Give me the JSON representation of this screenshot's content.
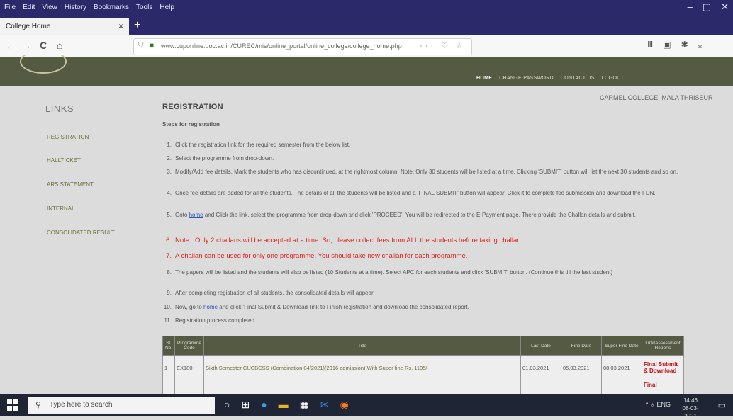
{
  "menu": [
    "File",
    "Edit",
    "View",
    "History",
    "Bookmarks",
    "Tools",
    "Help"
  ],
  "window_controls": [
    "–",
    "▢",
    "✕"
  ],
  "tab": {
    "title": "College Home",
    "close": "×"
  },
  "new_tab": "+",
  "nav": {
    "back": "←",
    "forward": "→",
    "reload": "C",
    "home": "⌂"
  },
  "url": "www.cuponline.uoc.ac.in/CUREC/mis/online_portal/online_college/college_home.php",
  "url_icons": "··· ♡ ☆",
  "toolbar_icons": [
    "Ⅲ",
    "▣",
    "✱",
    "⤓"
  ],
  "site_nav": [
    "HOME",
    "CHANGE PASSWORD",
    "CONTACT US",
    "LOGOUT"
  ],
  "college_name": "CARMEL COLLEGE, MALA THRISSUR",
  "links_title": "LINKS",
  "side_links": [
    "REGISTRATION",
    "HALLTICKET",
    "ARS STATEMENT",
    "INTERNAL",
    "CONSOLIDATED RESULT"
  ],
  "registration_title": "REGISTRATION",
  "steps_heading": "Steps for registration",
  "steps": [
    {
      "n": "1.",
      "text": "Click the registration link for the required semester from the below list."
    },
    {
      "n": "2.",
      "text": "Select the programme from drop-down."
    },
    {
      "n": "3.",
      "text": "Modify/Add fee details. Mark the students who has discontinued, at the rightmost column. Note: Only 30 students will be listed at a time. Clicking 'SUBMIT' button will list the next 30 students and so on."
    },
    {
      "n": "4.",
      "text": "Once fee details are added for all the students. The details of all the students will be listed and a 'FINAL SUBMIT' button will appear. Click it to complete fee submission and download the FDN."
    },
    {
      "n": "5.",
      "pre": "Goto ",
      "link": "home",
      "post": " and Click the link, select the programme from drop-down and click 'PROCEED'. You will be redirected to the E-Payment page. There provide the Challan details and submit."
    },
    {
      "n": "6.",
      "text": "Note : Only 2 challans will be accepted at a time. So, please collect fees from ALL the students before taking challan."
    },
    {
      "n": "7.",
      "text": "A challan can be used for only one programme. You should take new challan for each programme."
    },
    {
      "n": "8.",
      "text": "The papers will be listed and the students will also be listed (10 Students at a time). Select APC for each students and click 'SUBMIT' button. (Continue this till the last student)"
    },
    {
      "n": "9.",
      "text": "After completing registration of all students, the consolidated details will appear."
    },
    {
      "n": "10.",
      "pre": "Now, go to ",
      "link": "home",
      "post": " and click 'Final Submit & Download' link to Finish registration and download the consolidated report."
    },
    {
      "n": "11.",
      "text": "Registration process completed."
    }
  ],
  "table": {
    "headers": [
      "Sl. No.",
      "Programme Code",
      "Title",
      "Last Date",
      "Fine Date",
      "Super Fine Date",
      "Link/Assessment Reports"
    ],
    "rows": [
      {
        "sl": "1",
        "code": "EX180",
        "title": "Sixth Semester CUCBCSS (Combination 04/2021)(2016 admission) With Super fine Rs. 1105/-",
        "last": "01.03.2021",
        "fine": "05.03.2021",
        "super": "08.03.2021",
        "action": "Final Submit & Download"
      },
      {
        "sl": "",
        "code": "",
        "title": "",
        "last": "",
        "fine": "",
        "super": "",
        "action": "Final"
      }
    ]
  },
  "taskbar": {
    "search_placeholder": "Type here to search",
    "time": "14:46",
    "date": "08-03-2021",
    "tray": "^ ♁ ENG"
  },
  "colors": {
    "titlebar": "#2a2a6a",
    "header": "#555a43",
    "note_red": "#e0241b",
    "action_red": "#c0141b",
    "link_olive": "#6e6e3c"
  }
}
